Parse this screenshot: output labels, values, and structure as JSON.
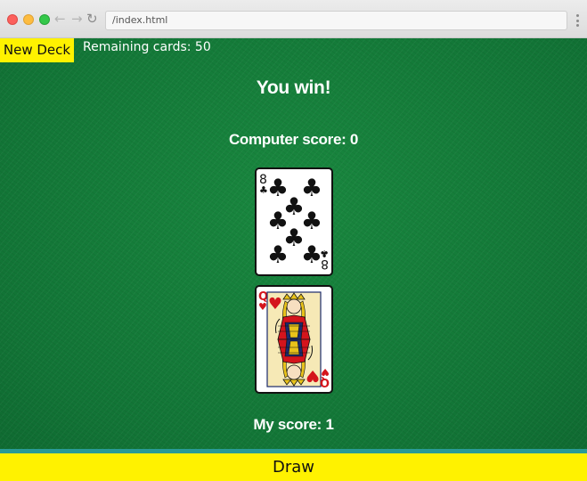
{
  "browser": {
    "url": "/index.html",
    "icons": {
      "back": "back-arrow-icon",
      "forward": "forward-arrow-icon",
      "reload": "reload-icon",
      "menu": "kebab-menu-icon"
    }
  },
  "game": {
    "new_deck_label": "New Deck",
    "remaining_text": "Remaining cards: 50",
    "result_text": "You win!",
    "computer_score_text": "Computer score: 0",
    "my_score_text": "My score: 1",
    "draw_label": "Draw",
    "computer_card": {
      "rank": "8",
      "suit": "clubs",
      "suit_symbol": "♣",
      "color": "#111111"
    },
    "player_card": {
      "rank": "Q",
      "suit": "hearts",
      "suit_symbol": "♥",
      "color": "#d4141c"
    }
  },
  "colors": {
    "felt": "#157e3e",
    "button_yellow": "#fff200",
    "text_white": "#ffffff"
  }
}
